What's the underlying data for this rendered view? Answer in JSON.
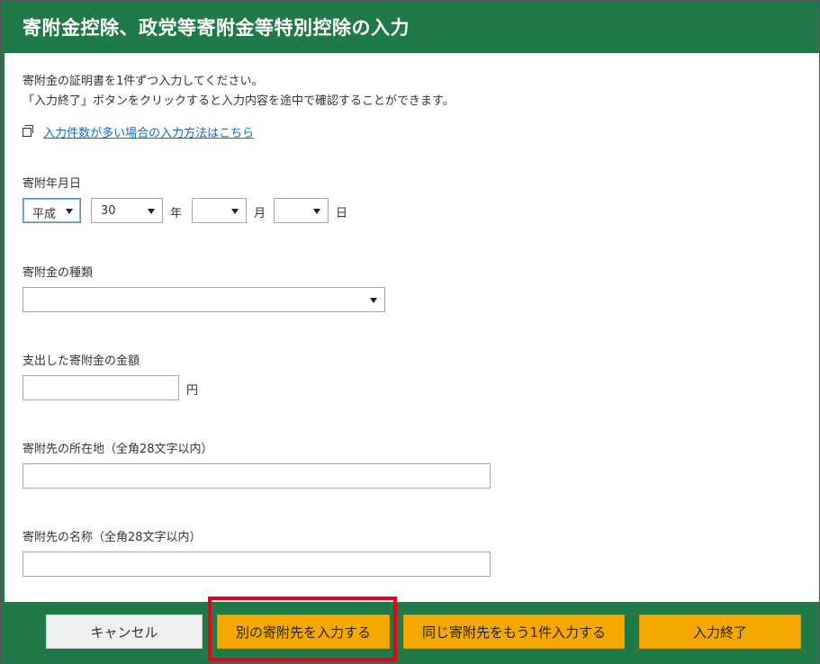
{
  "header": {
    "title": "寄附金控除、政党等寄附金等特別控除の入力"
  },
  "intro": {
    "line1": "寄附金の証明書を1件ずつ入力してください。",
    "line2": "「入力終了」ボタンをクリックすると入力内容を途中で確認することができます。"
  },
  "link": {
    "icon": "external-window-icon",
    "text": "入力件数が多い場合の入力方法はこちら"
  },
  "date_field": {
    "label": "寄附年月日",
    "era_value": "平成",
    "year_value": "30",
    "year_unit": "年",
    "month_value": "",
    "month_unit": "月",
    "day_value": "",
    "day_unit": "日"
  },
  "type_field": {
    "label": "寄附金の種類",
    "value": ""
  },
  "amount_field": {
    "label": "支出した寄附金の金額",
    "value": "",
    "unit": "円"
  },
  "address_field": {
    "label": "寄附先の所在地（全角28文字以内）",
    "value": ""
  },
  "name_field": {
    "label": "寄附先の名称（全角28文字以内）",
    "value": ""
  },
  "footer": {
    "cancel_label": "キャンセル",
    "other_donee_label": "別の寄附先を入力する",
    "same_donee_label": "同じ寄附先をもう1件入力する",
    "finish_label": "入力終了"
  },
  "colors": {
    "header_green": "#1f7a48",
    "button_orange": "#f5a800",
    "highlight_red": "#e8001c",
    "link_blue": "#0b6ec5"
  }
}
